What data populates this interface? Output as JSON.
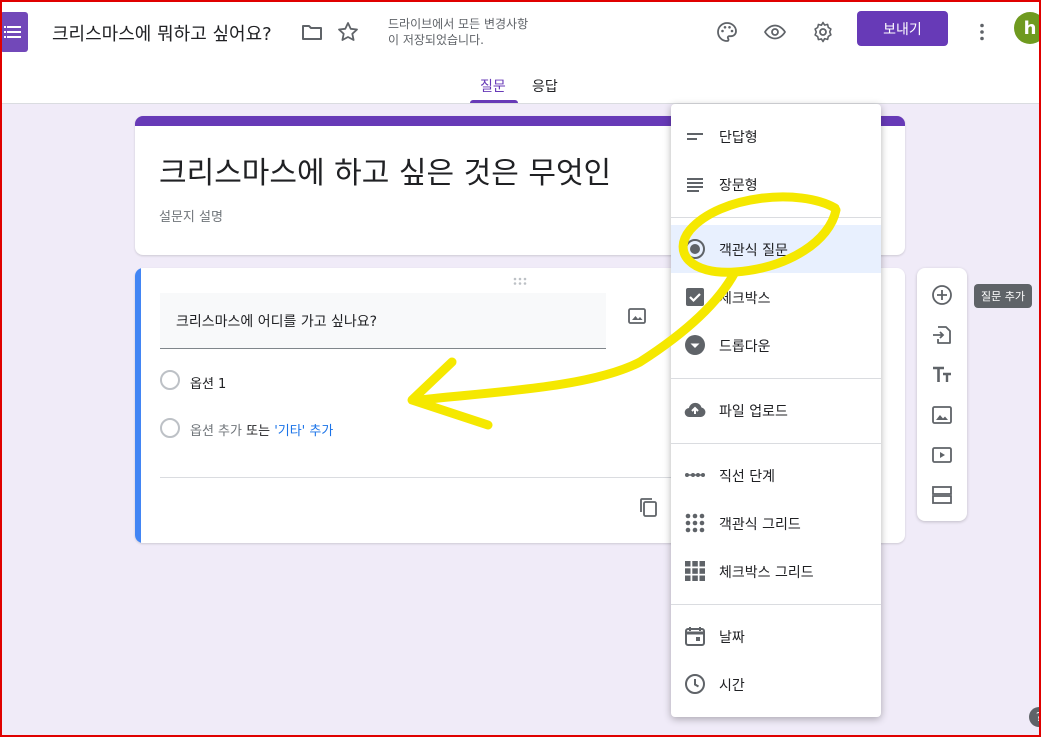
{
  "header": {
    "title": "크리스마스에 뭐하고 싶어요?",
    "save_status_line1": "드라이브에서 모든 변경사항",
    "save_status_line2": "이 저장되었습니다.",
    "send_label": "보내기",
    "avatar_initial": "h",
    "icons": [
      "forms-logo-icon",
      "folder-icon",
      "star-icon",
      "palette-icon",
      "eye-icon",
      "gear-icon",
      "more-vert-icon"
    ]
  },
  "tabs": [
    {
      "label": "질문",
      "active": true
    },
    {
      "label": "응답",
      "active": false
    }
  ],
  "form": {
    "title": "크리스마스에 하고 싶은 것은 무엇인",
    "description": "설문지 설명"
  },
  "question": {
    "text": "크리스마스에 어디를 가고 싶나요?",
    "options": [
      "옵션 1"
    ],
    "add_option": "옵션 추가",
    "or_text": "또는",
    "add_other": "'기타' 추가"
  },
  "side_toolbar": {
    "tooltip": "질문 추가",
    "icons": [
      "add-circle-icon",
      "import-icon",
      "title-icon",
      "image-icon",
      "video-icon",
      "section-icon"
    ]
  },
  "menu": {
    "items": [
      {
        "label": "단답형",
        "icon": "short-text-icon"
      },
      {
        "label": "장문형",
        "icon": "paragraph-icon"
      },
      {
        "label": "객관식 질문",
        "icon": "radio-icon",
        "selected": true
      },
      {
        "label": "체크박스",
        "icon": "checkbox-icon"
      },
      {
        "label": "드롭다운",
        "icon": "dropdown-icon"
      },
      {
        "label": "파일 업로드",
        "icon": "cloud-upload-icon"
      },
      {
        "label": "직선 단계",
        "icon": "linear-scale-icon"
      },
      {
        "label": "객관식 그리드",
        "icon": "grid-dots-icon"
      },
      {
        "label": "체크박스 그리드",
        "icon": "grid-squares-icon"
      },
      {
        "label": "날짜",
        "icon": "calendar-icon"
      },
      {
        "label": "시간",
        "icon": "clock-icon"
      }
    ]
  },
  "colors": {
    "accent": "#673ab7",
    "background": "#f0ebf8",
    "question_accent": "#4285f4",
    "highlight_annotation": "#f5e800"
  }
}
